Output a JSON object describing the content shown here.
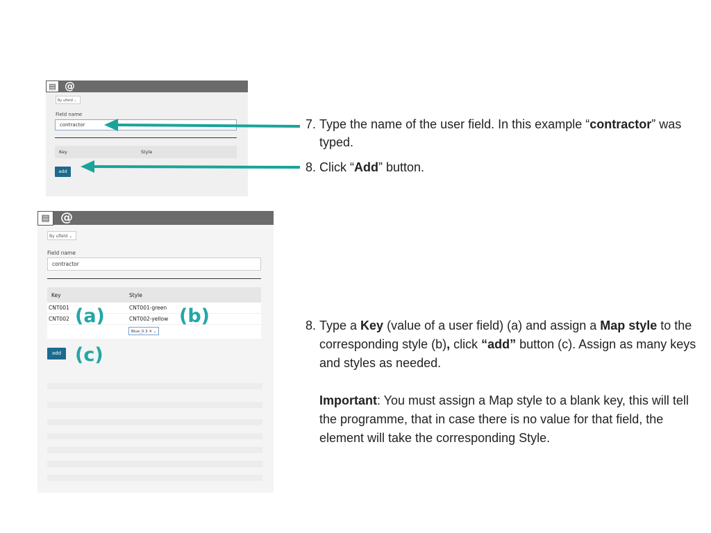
{
  "screenshot1": {
    "icon": "list-icon",
    "at_symbol": "@",
    "dropdown_value": "By ufield",
    "field_name_label": "Field name",
    "field_name_value": "contractor",
    "table_header": {
      "key": "Key",
      "style": "Style"
    },
    "add_label": "add"
  },
  "screenshot2": {
    "icon": "list-icon",
    "at_symbol": "@",
    "dropdown_value": "By ufield",
    "field_name_label": "Field name",
    "field_name_value": "contractor",
    "table_header": {
      "key": "Key",
      "style": "Style"
    },
    "rows": [
      {
        "key": "CNT001",
        "style": "CNT001-green"
      },
      {
        "key": "CNT002",
        "style": "CNT002-yellow"
      }
    ],
    "style_chip": "Blue_0.3",
    "add_label": "add",
    "callouts": {
      "a": "(a)",
      "b": "(b)",
      "c": "(c)"
    }
  },
  "steps": {
    "step7": {
      "number": "7.",
      "t1": "Type the name of the user field. In this example “",
      "b1": "contractor",
      "t2": "” was typed."
    },
    "step8a": {
      "number": "8.",
      "t1": "Click “",
      "b1": "Add",
      "t2": "” button."
    },
    "step8b": {
      "number": "8.",
      "t1": "Type a ",
      "b1": "Key",
      "t2": " (value of a user field) (a) and assign a ",
      "b2": "Map style",
      "t3": "  to the corresponding style (b)",
      "b3": ",",
      "t4": " click ",
      "b4": "“add”",
      "t5": " button (c). Assign as many keys and styles as needed.",
      "important_label": "Important",
      "important_text": ": You must assign a Map style  to a blank key, this will tell the programme, that in case there is no value for that field, the element will take the corresponding Style."
    }
  },
  "colors": {
    "arrow": "#1aa39a",
    "callout": "#23a6a6",
    "button": "#1c6a8e"
  }
}
